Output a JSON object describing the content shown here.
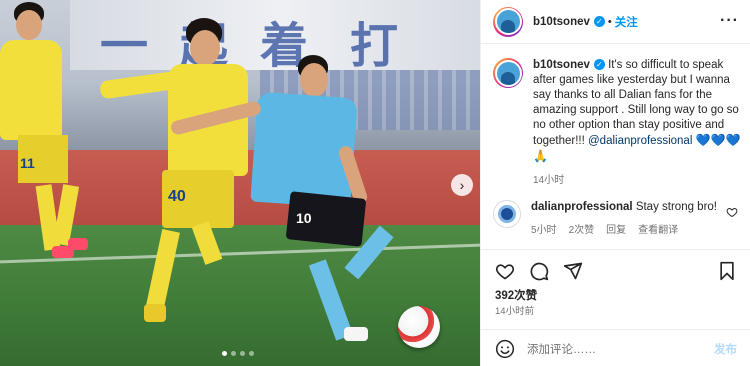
{
  "post": {
    "photo": {
      "banner_text": "一起着打",
      "yellow_numbers": [
        "40",
        "11"
      ],
      "blue_number": "10",
      "carousel_next_glyph": "›",
      "dots_count": 4,
      "active_dot": 1
    },
    "header": {
      "username": "b10tsonev",
      "verified_glyph": "✓",
      "separator": "•",
      "follow_label": "关注",
      "more_glyph": "···"
    },
    "caption": {
      "username": "b10tsonev",
      "text": "It's so difficult to speak after games like yesterday but I wanna say thanks to all Dalian fans for the amazing support . Still long way to go so no other option than stay positive and together!!!",
      "mention": "@dalianprofessional",
      "emojis": "💙💙💙🙏",
      "time": "14小时"
    },
    "comment": {
      "username": "dalianprofessional",
      "text": "Stay strong bro!",
      "time": "5小时",
      "likes": "2次赞",
      "reply": "回复",
      "translate": "查看翻译"
    },
    "actions": {
      "likes": "392次赞",
      "ago": "14小时前"
    },
    "composer": {
      "placeholder": "添加评论……",
      "post_label": "发布"
    }
  },
  "colors": {
    "accent": "#0095f6",
    "muted": "#737373",
    "mention": "#00376b",
    "yellow_kit": "#f2df3c",
    "blue_kit": "#5bb7e3"
  },
  "icons": [
    "heart-icon",
    "comment-icon",
    "share-icon",
    "bookmark-icon",
    "emoji-icon",
    "more-icon",
    "verified-icon",
    "chevron-right-icon"
  ]
}
